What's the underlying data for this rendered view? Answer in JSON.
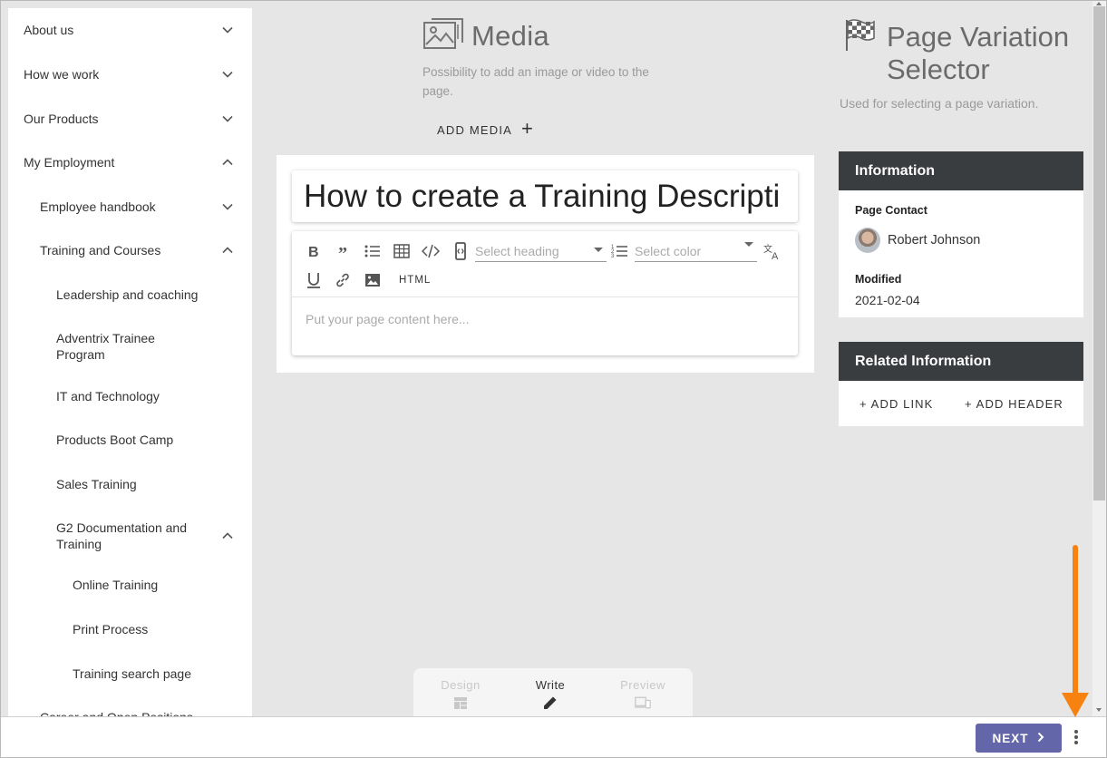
{
  "sidebar": {
    "items": [
      {
        "label": "About us",
        "chevron": "down"
      },
      {
        "label": "How we work",
        "chevron": "down"
      },
      {
        "label": "Our Products",
        "chevron": "down"
      },
      {
        "label": "My Employment",
        "chevron": "up"
      },
      {
        "label": "Employee handbook",
        "chevron": "down"
      },
      {
        "label": "Training and Courses",
        "chevron": "up"
      },
      {
        "label": "Leadership and coaching"
      },
      {
        "label": "Adventrix Trainee Program"
      },
      {
        "label": "IT and Technology"
      },
      {
        "label": "Products Boot Camp"
      },
      {
        "label": "Sales Training"
      },
      {
        "label": "G2 Documentation and Training",
        "chevron": "up"
      },
      {
        "label": "Online Training"
      },
      {
        "label": "Print Process"
      },
      {
        "label": "Training search page"
      },
      {
        "label": "Career and Open Positions"
      }
    ]
  },
  "media": {
    "title": "Media",
    "description": "Possibility to add an image or video to the page.",
    "add_label": "ADD MEDIA",
    "icon": "image-gallery-icon"
  },
  "editor": {
    "page_title": "How to create a Training Descripti",
    "heading_placeholder": "Select heading",
    "color_placeholder": "Select color",
    "html_label": "HTML",
    "content_placeholder": "Put your page content here..."
  },
  "page_variation": {
    "title": "Page Variation Selector",
    "description": "Used for selecting a page variation.",
    "icon": "checkered-flag-icon"
  },
  "information": {
    "header": "Information",
    "contact_label": "Page Contact",
    "contact_name": "Robert Johnson",
    "modified_label": "Modified",
    "modified_value": "2021-02-04"
  },
  "related": {
    "header": "Related Information",
    "add_link": "+ ADD LINK",
    "add_header": "+ ADD HEADER"
  },
  "modes": {
    "design": "Design",
    "write": "Write",
    "preview": "Preview",
    "active": "write"
  },
  "footer": {
    "next_label": "NEXT"
  },
  "colors": {
    "accent": "#6466aa",
    "card_header": "#3a3d40",
    "annotation": "#f7820f",
    "background": "#e6e6e6"
  }
}
